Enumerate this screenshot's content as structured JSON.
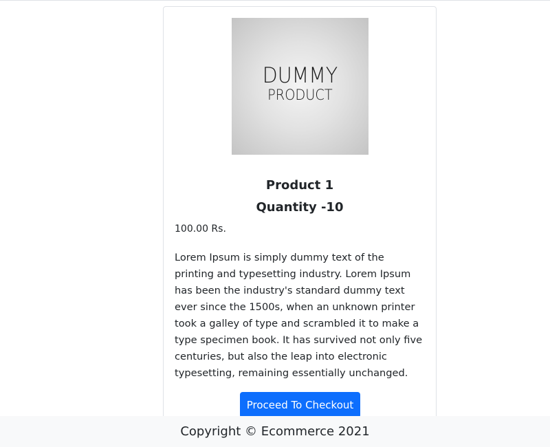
{
  "product": {
    "image": {
      "line1": "DUMMY",
      "line2": "PRODUCT"
    },
    "name": "Product 1",
    "quantity_label": "Quantity -10",
    "price": "100.00 Rs.",
    "description": "Lorem Ipsum is simply dummy text of the printing and typesetting industry. Lorem Ipsum has been the industry's standard dummy text ever since the 1500s, when an unknown printer took a galley of type and scrambled it to make a type specimen book. It has survived not only five centuries, but also the leap into electronic typesetting, remaining essentially unchanged.",
    "checkout_button": "Proceed To Checkout"
  },
  "footer": {
    "copyright": "Copyright © Ecommerce 2021"
  },
  "colors": {
    "primary": "#0d6efd",
    "footer_bg": "#f8f9fa",
    "text": "#212529"
  }
}
